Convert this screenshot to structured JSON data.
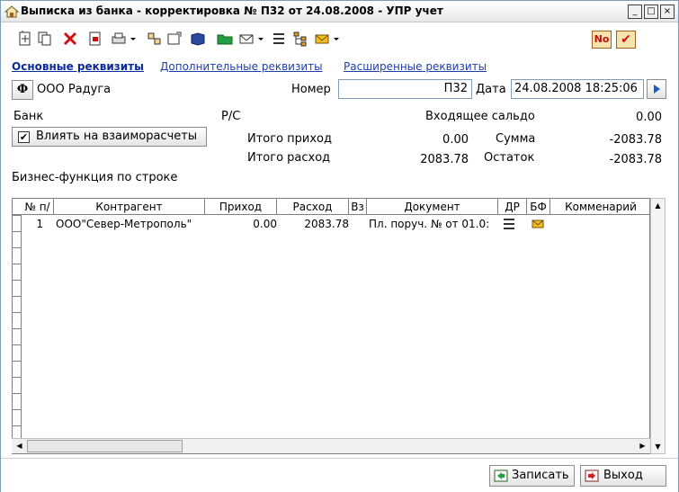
{
  "window": {
    "title": "Выписка из банка  - корректировка № П32 от 24.08.2008 - УПР учет",
    "minimize": "_",
    "maximize": "□",
    "close": "×"
  },
  "toolbar": {
    "icons": [
      "new-doc-icon",
      "copy-doc-icon",
      "delete-icon",
      "open-doc-icon",
      "print-icon",
      "print-dropdown-icon",
      "structure-icon",
      "properties-icon",
      "book-icon",
      "folder-icon",
      "email-icon",
      "email-dropdown-icon",
      "list-icon",
      "tree-icon",
      "envelope-icon",
      "envelope-dropdown-icon"
    ],
    "no_label": "No",
    "check_label": "✔"
  },
  "tabs": [
    {
      "label": "Основные реквизиты",
      "active": true
    },
    {
      "label": "Дополнительные реквизиты",
      "active": false
    },
    {
      "label": "Расширенные реквизиты",
      "active": false
    }
  ],
  "header": {
    "firm_button": "Ф",
    "firm_name": "ООО Радуга",
    "number_label": "Номер",
    "number_value": "П32",
    "date_label": "Дата",
    "date_value": "24.08.2008 18:25:06"
  },
  "summary": {
    "bank_label": "Банк",
    "account_label": "Р/С",
    "opening_balance_label": "Входящее сальдо",
    "opening_balance_value": "0.00",
    "checkbox_label": "Влиять на взаиморасчеты",
    "checkbox_checked": true,
    "total_in_label": "Итого приход",
    "total_in_value": "0.00",
    "sum_label": "Сумма",
    "sum_value": "-2083.78",
    "total_out_label": "Итого расход",
    "total_out_value": "2083.78",
    "rest_label": "Остаток",
    "rest_value": "-2083.78",
    "business_label": "Бизнес-функция по строке"
  },
  "table": {
    "columns": [
      "№ п/",
      "Контрагент",
      "Приход",
      "Расход",
      "Вз",
      "Документ",
      "ДР",
      "БФ",
      "Комменарий"
    ],
    "rows": [
      {
        "num": "1",
        "counterparty": "ООО\"Север-Метрополь\"",
        "income": "0.00",
        "expense": "2083.78",
        "vz": "",
        "document": "Пл. поруч. №  от 01.0:",
        "dr": "list-icon",
        "bf": "envelope-icon",
        "comment": ""
      }
    ]
  },
  "footer": {
    "save_label": "Записать",
    "exit_label": "Выход"
  }
}
